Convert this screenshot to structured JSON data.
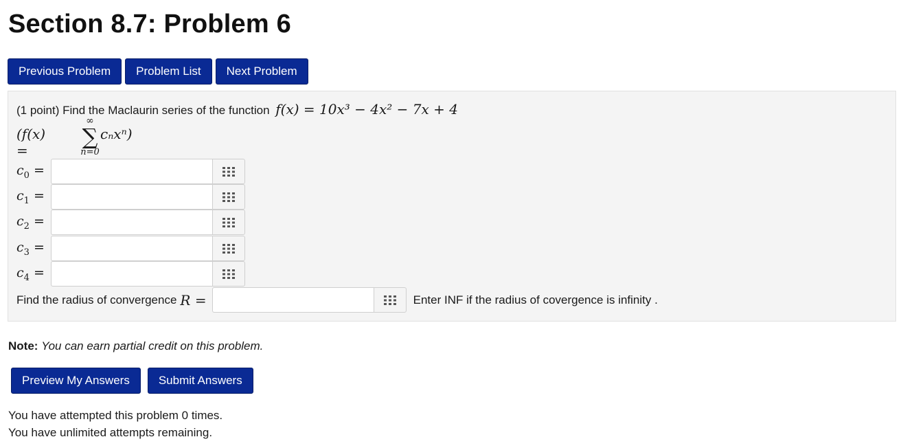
{
  "page": {
    "title": "Section 8.7: Problem 6"
  },
  "nav": {
    "previous_label": "Previous Problem",
    "list_label": "Problem List",
    "next_label": "Next Problem"
  },
  "problem": {
    "prompt_text": "(1 point) Find the Maclaurin series of the function",
    "function_tex": "f(x) = 10x³ − 4x² − 7x + 4",
    "series": {
      "lhs": "(f(x) =",
      "upper": "∞",
      "sigma": "∑",
      "lower": "n=0",
      "term": "cₙxⁿ)"
    },
    "coefficients": [
      {
        "symbol": "c",
        "index": "0",
        "equals": "=",
        "value": ""
      },
      {
        "symbol": "c",
        "index": "1",
        "equals": "=",
        "value": ""
      },
      {
        "symbol": "c",
        "index": "2",
        "equals": "=",
        "value": ""
      },
      {
        "symbol": "c",
        "index": "3",
        "equals": "=",
        "value": ""
      },
      {
        "symbol": "c",
        "index": "4",
        "equals": "=",
        "value": ""
      }
    ],
    "radius": {
      "label": "Find the radius of convergence",
      "math": "R =",
      "value": "",
      "hint": "Enter INF if the radius of covergence is infinity ."
    }
  },
  "note": {
    "label": "Note:",
    "text": "You can earn partial credit on this problem."
  },
  "actions": {
    "preview_label": "Preview My Answers",
    "submit_label": "Submit Answers"
  },
  "attempts": {
    "line1": "You have attempted this problem 0 times.",
    "line2": "You have unlimited attempts remaining."
  },
  "icons": {
    "palette": "grid-icon"
  },
  "colors": {
    "button": "#0a2a94",
    "panel": "#f4f4f4",
    "icon": "#555555"
  }
}
